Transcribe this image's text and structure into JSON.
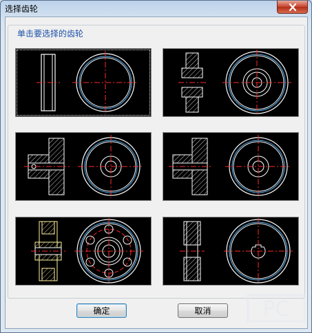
{
  "window": {
    "title": "选择齿轮"
  },
  "group": {
    "label": "单击要选择的齿轮"
  },
  "buttons": {
    "ok_label": "确定",
    "cancel_label": "取消"
  },
  "gears": [
    {
      "id": "gear-1",
      "selected": true
    },
    {
      "id": "gear-2",
      "selected": false
    },
    {
      "id": "gear-3",
      "selected": false
    },
    {
      "id": "gear-4",
      "selected": false
    },
    {
      "id": "gear-5",
      "selected": false
    },
    {
      "id": "gear-6",
      "selected": false
    }
  ],
  "colors": {
    "drawing_bg": "#000000",
    "outline": "#ffffff",
    "centerline": "#ff2a2a",
    "pitch_circle": "#59b9ff",
    "hatch": "#ffffff",
    "highlight": "#fff3a0"
  },
  "watermark": {
    "text": "PC"
  }
}
